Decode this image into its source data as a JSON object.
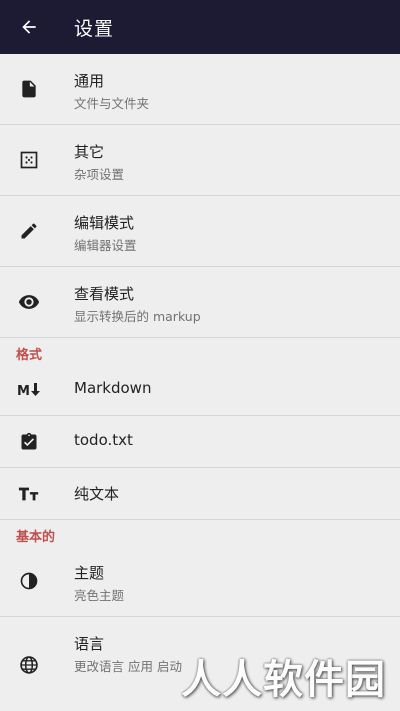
{
  "appbar": {
    "title": "设置",
    "back_icon": "arrow-left-icon"
  },
  "general_items": [
    {
      "title": "通用",
      "subtitle": "文件与文件夹",
      "icon": "file-icon"
    },
    {
      "title": "其它",
      "subtitle": "杂项设置",
      "icon": "dots-square-icon"
    },
    {
      "title": "编辑模式",
      "subtitle": "编辑器设置",
      "icon": "pencil-icon"
    },
    {
      "title": "查看模式",
      "subtitle": "显示转换后的 markup",
      "icon": "eye-icon"
    }
  ],
  "format_section": {
    "header": "格式",
    "items": [
      {
        "title": "Markdown",
        "icon": "markdown-icon"
      },
      {
        "title": "todo.txt",
        "icon": "clipboard-check-icon"
      },
      {
        "title": "纯文本",
        "icon": "text-size-icon"
      }
    ]
  },
  "basic_section": {
    "header": "基本的",
    "items": [
      {
        "title": "主题",
        "subtitle": "亮色主题",
        "icon": "contrast-icon"
      },
      {
        "title": "语言",
        "subtitle": "更改语言 应用 启动",
        "icon": "globe-icon"
      }
    ]
  },
  "watermark": "人人软件园",
  "colors": {
    "appbar": "#1c1b33",
    "background": "#eeeeee",
    "section_header": "#c0504d"
  }
}
